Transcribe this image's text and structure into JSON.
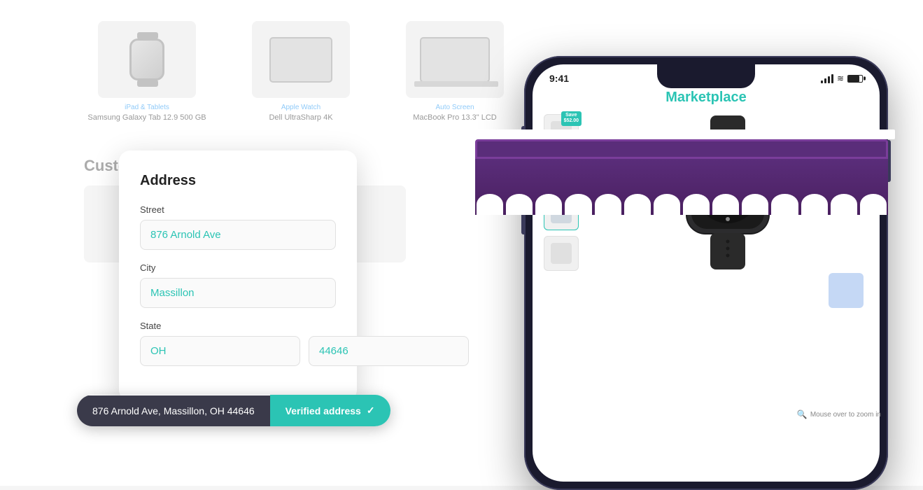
{
  "background": {
    "products": [
      {
        "category": "iPad & Tablets",
        "name": "Samsung Galaxy Tab 12.9 500 GB",
        "type": "watch",
        "dot_label": "•"
      },
      {
        "category": "Apple Watch",
        "name": "Dell UltraSharp 4K",
        "type": "tablet",
        "dot_label": "•"
      },
      {
        "category": "Auto Screen",
        "name": "MacBook Pro 13.3\" LCD",
        "type": "laptop",
        "dot_label": "•"
      }
    ],
    "bottom_title": "Customers Also Bought"
  },
  "address_card": {
    "title": "Address",
    "street_label": "Street",
    "street_value": "876 Arnold Ave",
    "city_label": "City",
    "city_value": "Massillon",
    "state_label": "State",
    "state_value": "OH",
    "zip_value": "44646"
  },
  "address_bar": {
    "address_text": "876 Arnold Ave, Massillon, OH 44646",
    "verified_label": "Verified address",
    "check_symbol": "✓"
  },
  "phone": {
    "status_bar": {
      "time": "9:41",
      "signal": "●●●",
      "wifi": "wifi",
      "battery": "battery"
    },
    "app_title": "Marketplace",
    "save_badge_line1": "Save",
    "save_badge_line2": "$52.00",
    "zoom_hint": "Mouse over to zoom in",
    "thumbnails": [
      {
        "label": "thumb-1"
      },
      {
        "label": "thumb-2"
      },
      {
        "label": "thumb-3"
      },
      {
        "label": "thumb-4"
      }
    ]
  },
  "awning": {
    "color": "#5a2d7a"
  },
  "colors": {
    "teal": "#2bc4b4",
    "dark_purple": "#5a2d7a",
    "dark_nav": "#3a3a4a",
    "phone_frame": "#1a1a2e"
  }
}
